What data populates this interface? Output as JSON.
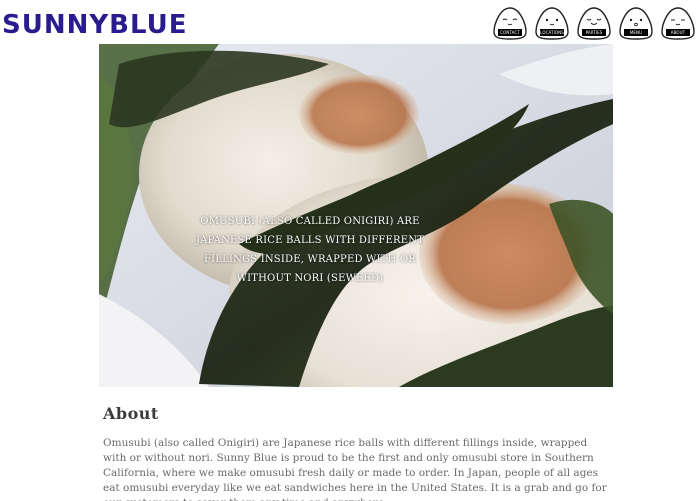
{
  "header": {
    "logo": "SUNNYBLUE",
    "nav": [
      {
        "label": "CONTACT"
      },
      {
        "label": "LOCATIONS"
      },
      {
        "label": "PARTIES"
      },
      {
        "label": "MENU"
      },
      {
        "label": "ABOUT"
      }
    ]
  },
  "hero": {
    "caption": "Omusubi (also called Onigiri) are Japanese rice balls with different fillings inside, wrapped with or without nori (seweed)"
  },
  "about": {
    "title": "About",
    "body": "Omusubi (also called Onigiri) are Japanese rice balls with different fillings inside, wrapped with or without nori. Sunny Blue is proud to be the first and only omusubi store in Southern California, where we make omusubi fresh daily or made to order. In Japan, people of all ages eat omusubi everyday like we eat sandwiches here in the United States. It is a grab and go for our customers to savor them any time and anywhere."
  },
  "colors": {
    "logo": "#2a1c8e",
    "text": "#6a6a6a"
  }
}
